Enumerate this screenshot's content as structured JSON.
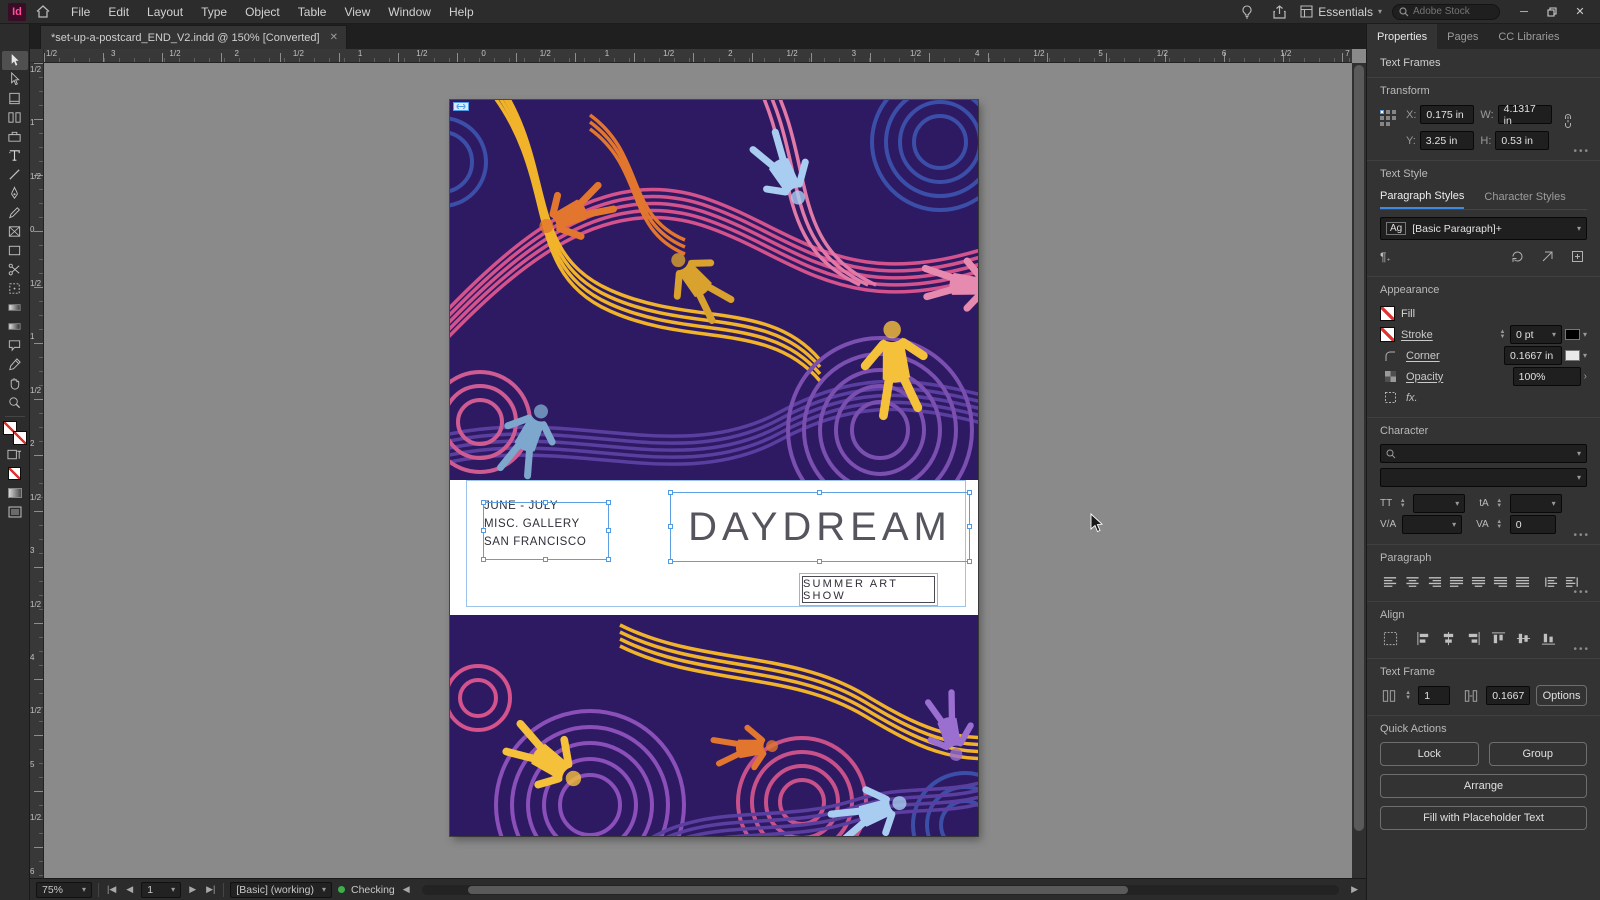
{
  "titlebar": {
    "workspace": "Essentials",
    "search_placeholder": "Adobe Stock"
  },
  "menu": {
    "items": [
      "File",
      "Edit",
      "Layout",
      "Type",
      "Object",
      "Table",
      "View",
      "Window",
      "Help"
    ]
  },
  "doc_tab": {
    "title": "*set-up-a-postcard_END_V2.indd @ 150% [Converted]"
  },
  "rulers": {
    "top": [
      "1/2",
      "3",
      "1/2",
      "2",
      "1/2",
      "1",
      "1/2",
      "0",
      "1/2",
      "1",
      "1/2",
      "2",
      "1/2",
      "3",
      "1/2",
      "4",
      "1/2",
      "5",
      "1/2",
      "6",
      "1/2",
      "7"
    ],
    "left": [
      "1/2",
      "1",
      "1/2",
      "0",
      "1/2",
      "1",
      "1/2",
      "2",
      "1/2",
      "3",
      "1/2",
      "4",
      "1/2",
      "5",
      "1/2",
      "6"
    ]
  },
  "artboard": {
    "info_lines": [
      "JUNE - JULY",
      "MISC. GALLERY",
      "SAN FRANCISCO"
    ],
    "title": "DAYDREAM",
    "subtitle": "SUMMER ART SHOW"
  },
  "panel": {
    "tabs": [
      "Properties",
      "Pages",
      "CC Libraries"
    ],
    "header": "Text Frames",
    "transform": {
      "label": "Transform",
      "x_label": "X:",
      "x_value": "0.175 in",
      "y_label": "Y:",
      "y_value": "3.25 in",
      "w_label": "W:",
      "w_value": "4.1317 in",
      "h_label": "H:",
      "h_value": "0.53 in"
    },
    "text_style": {
      "label": "Text Style",
      "tab_paragraph": "Paragraph Styles",
      "tab_character": "Character Styles",
      "style_badge": "Ag",
      "style_name": "[Basic Paragraph]+"
    },
    "appearance": {
      "label": "Appearance",
      "fill_label": "Fill",
      "stroke_label": "Stroke",
      "stroke_value": "0 pt",
      "corner_label": "Corner",
      "corner_value": "0.1667 in",
      "opacity_label": "Opacity",
      "opacity_value": "100%",
      "fx_label": "fx."
    },
    "character": {
      "label": "Character",
      "size_icon": "TT",
      "leading_icon": "tA",
      "kern_icon": "V/A",
      "track_icon": "VA",
      "tracking_value": "0"
    },
    "paragraph": {
      "label": "Paragraph"
    },
    "align": {
      "label": "Align"
    },
    "text_frame": {
      "label": "Text Frame",
      "columns_value": "1",
      "gutter_value": "0.1667",
      "options_label": "Options"
    },
    "quick_actions": {
      "label": "Quick Actions",
      "lock": "Lock",
      "group": "Group",
      "arrange": "Arrange",
      "fill_placeholder": "Fill with Placeholder Text"
    }
  },
  "statusbar": {
    "zoom": "75%",
    "page": "1",
    "preflight_profile": "[Basic] (working)",
    "preflight_status": "Checking"
  }
}
